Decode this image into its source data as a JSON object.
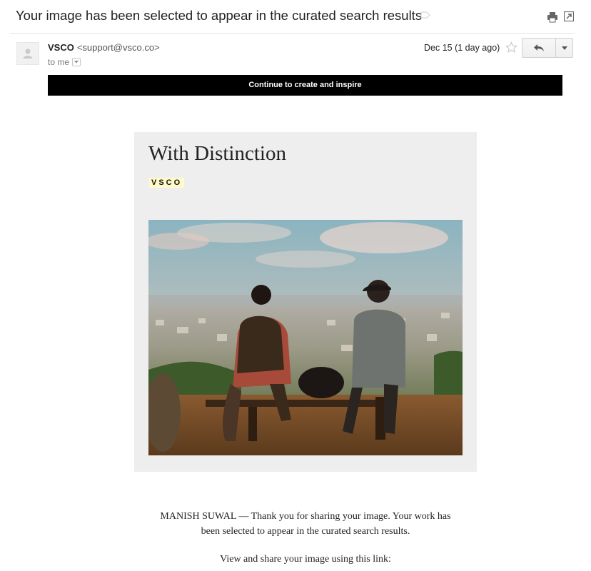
{
  "email": {
    "subject": "Your image has been selected to appear in the curated search results",
    "sender_name": "VSCO",
    "sender_email": "<support@vsco.co>",
    "recipient": "to me",
    "date": "Dec 15 (1 day ago)"
  },
  "banner": {
    "text": "Continue to create and inspire"
  },
  "card": {
    "title": "With Distinction",
    "logo_text": "VSCO"
  },
  "body": {
    "message": "MANISH SUWAL —  Thank you for sharing your image. Your work has been selected to appear in the curated search results.",
    "link_intro": "View and share your image using this link:"
  },
  "icons": {
    "label": "label-icon",
    "print": "print-icon",
    "popout": "popout-icon",
    "avatar": "person-icon",
    "star": "star-icon",
    "reply": "reply-icon",
    "more": "chevron-down-icon"
  },
  "colors": {
    "banner_bg": "#000000",
    "card_bg": "#eeeeee",
    "logo_highlight": "#fffbc8"
  }
}
